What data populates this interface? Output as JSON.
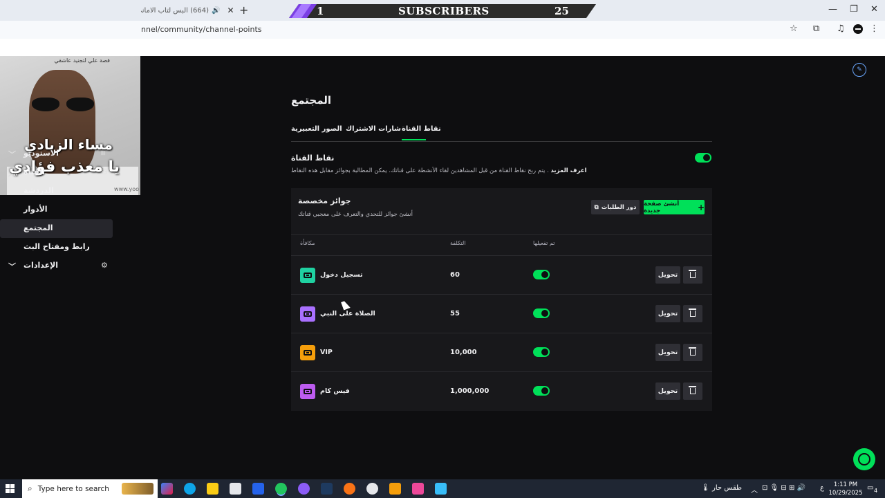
{
  "browser": {
    "tab_title": "(664) البس لتاب الاماني .. وا...",
    "url": "nnel/community/channel-points"
  },
  "overlay": {
    "left_number": "1",
    "label": "SUBSCRIBERS",
    "right_number": "25"
  },
  "webcam": {
    "top_caption": "قصة علي لتجنيد عاشقي",
    "caption_line1": "مساء الزبادي",
    "caption_line2": "يا معذب فؤادي",
    "watermark": "www.yoo"
  },
  "sidebar": {
    "items": [
      {
        "label": "الاستوديو",
        "chevron": "down"
      },
      {
        "label": "القناة",
        "chevron": "up"
      },
      {
        "label": "الدردشة"
      },
      {
        "label": "الأدوار"
      },
      {
        "label": "المجتمع",
        "active": true
      },
      {
        "label": "رابط ومفتاح البث"
      },
      {
        "label": "الإعدادات",
        "chevron": "down"
      }
    ]
  },
  "page": {
    "title": "المجتمع",
    "tabs": [
      "نقاط القناة",
      "شارات الاشتراك",
      "الصور التعبيرية"
    ],
    "active_tab": "نقاط القناة",
    "section_title": "نقاط القناة",
    "section_desc_bold": "اعرف المزيد",
    "section_desc": ". يتم ربح نقاط القناة من قبل المشاهدين لقاء الأنشطة على قناتك. يمكن المطالبة بجوائز مقابل هذه النقاط",
    "channel_points_enabled": true
  },
  "rewards": {
    "title": "جوائز مخصصة",
    "subtitle": "أنشئ جوائز للتحدي والتعرف على معجبي قناتك",
    "create_button": "أنشئ صفحة جديدة",
    "requests_button": "دور الطلبات",
    "columns": {
      "reward": "مكافأة",
      "cost": "التكلفة",
      "enabled": "تم تفعيلها"
    },
    "edit_label": "تحويل",
    "items": [
      {
        "name": "تسجيل دخول",
        "cost": "60",
        "enabled": true,
        "color": "#1fd1a1"
      },
      {
        "name": "الصلاة على النبي",
        "cost": "55",
        "enabled": true,
        "color": "#a970ff"
      },
      {
        "name": "VIP",
        "cost": "10,000",
        "enabled": true,
        "color": "#f59e0b"
      },
      {
        "name": "فيس كام",
        "cost": "1,000,000",
        "enabled": true,
        "color": "#bd5cf0"
      }
    ]
  },
  "taskbar": {
    "search_placeholder": "Type here to search",
    "weather": "طقس حار",
    "lang": "ع",
    "time": "1:11 PM",
    "date": "10/29/2025",
    "notif_count": "4"
  },
  "colors": {
    "accent": "#00e059",
    "background": "#0e0e10",
    "card": "#18181b"
  }
}
